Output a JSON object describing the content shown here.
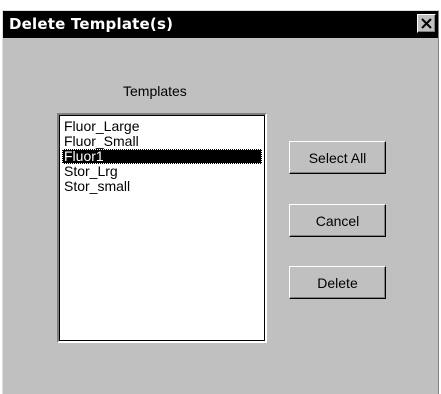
{
  "dialog": {
    "title": "Delete Template(s)",
    "close_glyph": "✕"
  },
  "templates": {
    "label": "Templates",
    "items": [
      {
        "label": "Fluor_Large",
        "selected": false
      },
      {
        "label": "Fluor_Small",
        "selected": false
      },
      {
        "label": "Fluor1",
        "selected": true
      },
      {
        "label": "Stor_Lrg",
        "selected": false
      },
      {
        "label": "Stor_small",
        "selected": false
      }
    ]
  },
  "buttons": {
    "select_all": "Select All",
    "cancel": "Cancel",
    "delete": "Delete"
  },
  "colors": {
    "face": "#c0c0c0",
    "titlebar": "#000000",
    "selection": "#000000"
  }
}
